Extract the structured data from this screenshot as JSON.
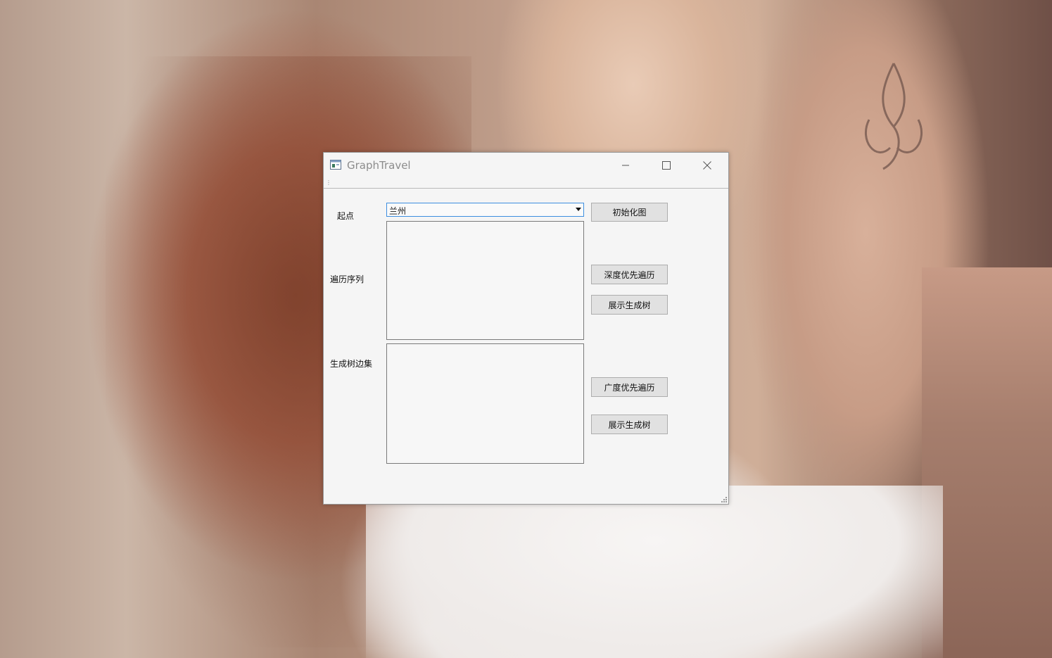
{
  "window": {
    "title": "GraphTravel",
    "icon": "app-window-icon",
    "controls": [
      "minimize-icon",
      "maximize-icon",
      "close-icon"
    ]
  },
  "form": {
    "start_label": "起点",
    "sequence_label": "遍历序列",
    "edges_label": "生成树边集",
    "start_combo": {
      "selected": "兰州"
    },
    "sequence_text": "",
    "edges_text": ""
  },
  "buttons": {
    "init": "初始化图",
    "dfs": "深度优先遍历",
    "dfs_tree": "展示生成树",
    "bfs": "广度优先遍历",
    "bfs_tree": "展示生成树"
  },
  "colors": {
    "window_bg": "#f5f5f5",
    "combo_focus_border": "#3d8ee0",
    "button_bg": "#e1e1e1",
    "title_text": "#8c8c8c"
  }
}
